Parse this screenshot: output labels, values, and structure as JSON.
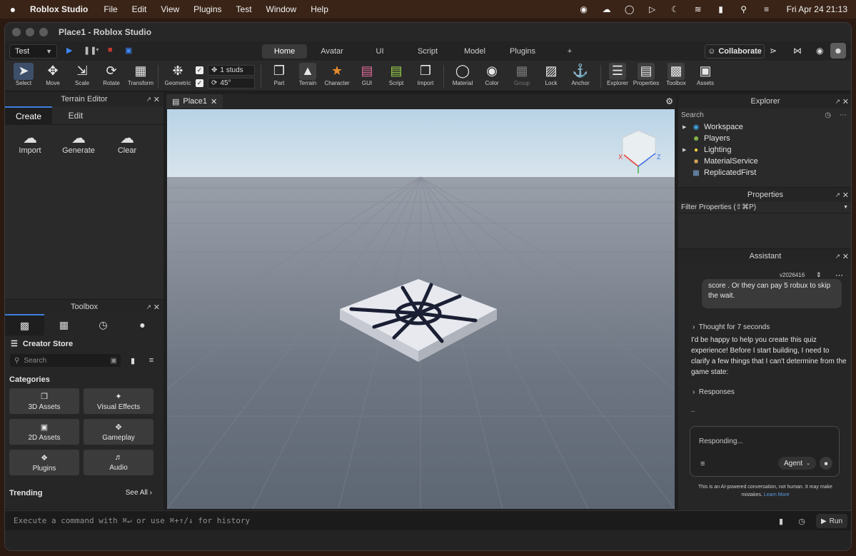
{
  "menubar": {
    "app_name": "Roblox Studio",
    "menus": [
      "File",
      "Edit",
      "View",
      "Plugins",
      "Test",
      "Window",
      "Help"
    ],
    "clock": "Fri Apr 24  21:13"
  },
  "window": {
    "title": "Place1 - Roblox Studio"
  },
  "tabrow": {
    "test_select": "Test",
    "tabs": [
      "Home",
      "Avatar",
      "UI",
      "Script",
      "Model",
      "Plugins"
    ],
    "add": "+",
    "collaborate": "Collaborate"
  },
  "toolbar": {
    "select": "Select",
    "move": "Move",
    "scale": "Scale",
    "rotate": "Rotate",
    "transform": "Transform",
    "geometric": "Geometric",
    "snap_move": "1 studs",
    "snap_rotate": "45°",
    "part": "Part",
    "terrain": "Terrain",
    "character": "Character",
    "gui": "GUI",
    "script": "Script",
    "import": "Import",
    "material": "Material",
    "color": "Color",
    "group": "Group",
    "lock": "Lock",
    "anchor": "Anchor",
    "explorer": "Explorer",
    "properties": "Properties",
    "toolbox": "Toolbox",
    "assets": "Assets"
  },
  "terrain_editor": {
    "title": "Terrain Editor",
    "tabs": [
      "Create",
      "Edit"
    ],
    "buttons": [
      "Import",
      "Generate",
      "Clear"
    ]
  },
  "toolbox": {
    "title": "Toolbox",
    "store": "Creator Store",
    "search_placeholder": "Search",
    "categories_label": "Categories",
    "categories": [
      "3D Assets",
      "Visual Effects",
      "2D Assets",
      "Gameplay",
      "Plugins",
      "Audio"
    ],
    "trending": "Trending",
    "see_all": "See All"
  },
  "viewport": {
    "tab": "Place1"
  },
  "explorer": {
    "title": "Explorer",
    "search_placeholder": "Search",
    "items": [
      "Workspace",
      "Players",
      "Lighting",
      "MaterialService",
      "ReplicatedFirst"
    ]
  },
  "properties": {
    "title": "Properties",
    "filter": "Filter Properties (⇧⌘P)"
  },
  "assistant": {
    "title": "Assistant",
    "version": "v2026416",
    "user_bubble": "score . Or they can pay 5 robux to skip the wait.",
    "thought": "Thought for 7 seconds",
    "message": "I'd be happy to help you create this quiz experience! Before I start building, I need to clarify a few things that I can't determine from the game state:",
    "responses": "Responses",
    "dots": "..",
    "input_placeholder": "Responding...",
    "agent": "Agent",
    "disclaimer": "This is an AI-powered conversation, not human. It may make mistakes.",
    "learn_more": "Learn More"
  },
  "command_bar": {
    "placeholder": "Execute a command with ⌘↵ or use ⌘+↑/↓ for history",
    "run": "Run"
  }
}
